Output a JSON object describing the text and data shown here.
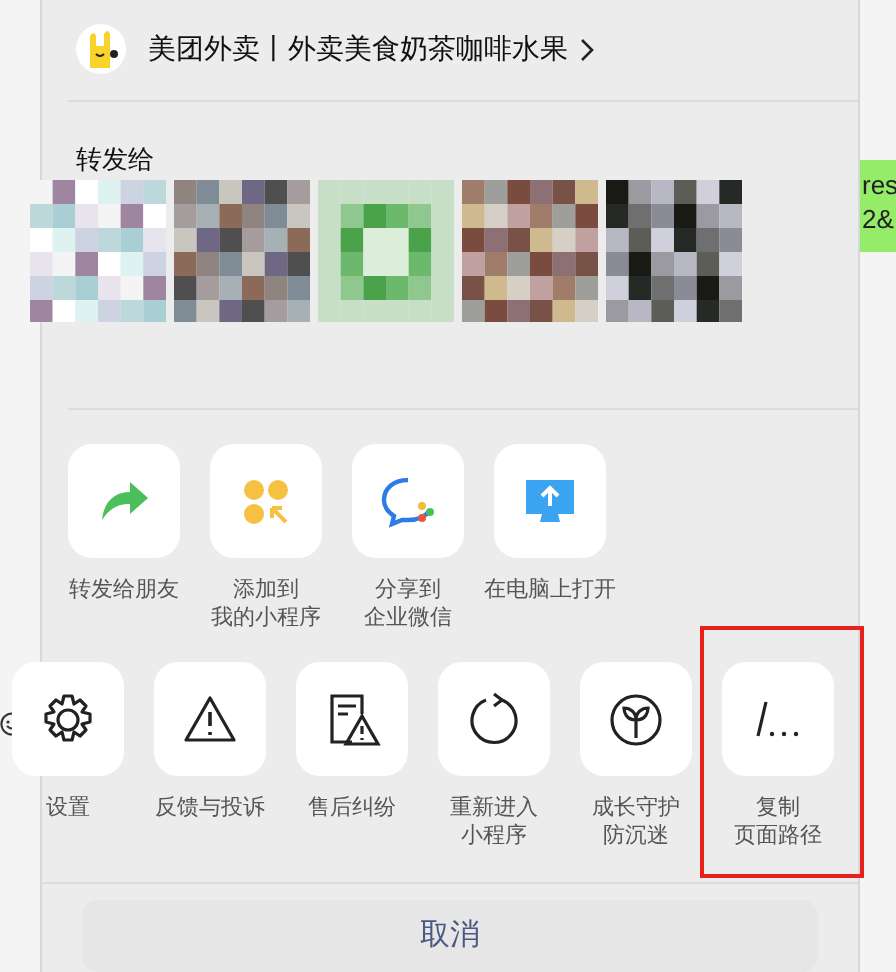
{
  "header": {
    "title": "美团外卖丨外卖美食奶茶咖啡水果"
  },
  "share": {
    "label": "转发给"
  },
  "actions_row_1": [
    {
      "kind": "share",
      "lines": [
        "转发给朋友"
      ],
      "highlighted": false
    },
    {
      "kind": "mini-program",
      "lines": [
        "添加到",
        "我的小程序"
      ],
      "highlighted": false
    },
    {
      "kind": "wecom",
      "lines": [
        "分享到",
        "企业微信"
      ],
      "highlighted": false
    },
    {
      "kind": "computer",
      "lines": [
        "在电脑上打开"
      ],
      "highlighted": false
    }
  ],
  "actions_row_2": [
    {
      "kind": "gear",
      "lines": [
        "设置"
      ],
      "highlighted": false
    },
    {
      "kind": "warning",
      "lines": [
        "反馈与投诉"
      ],
      "highlighted": false
    },
    {
      "kind": "document-warning",
      "lines": [
        "售后纠纷"
      ],
      "highlighted": false
    },
    {
      "kind": "reload",
      "lines": [
        "重新进入",
        "小程序"
      ],
      "highlighted": false
    },
    {
      "kind": "sprout",
      "lines": [
        "成长守护",
        "防沉迷"
      ],
      "highlighted": false
    },
    {
      "kind": "path",
      "lines": [
        "复制",
        "页面路径"
      ],
      "highlighted": true
    }
  ],
  "cancel_button": "取消",
  "background_chat": {
    "bubble_lines": [
      "res",
      "2&"
    ]
  }
}
